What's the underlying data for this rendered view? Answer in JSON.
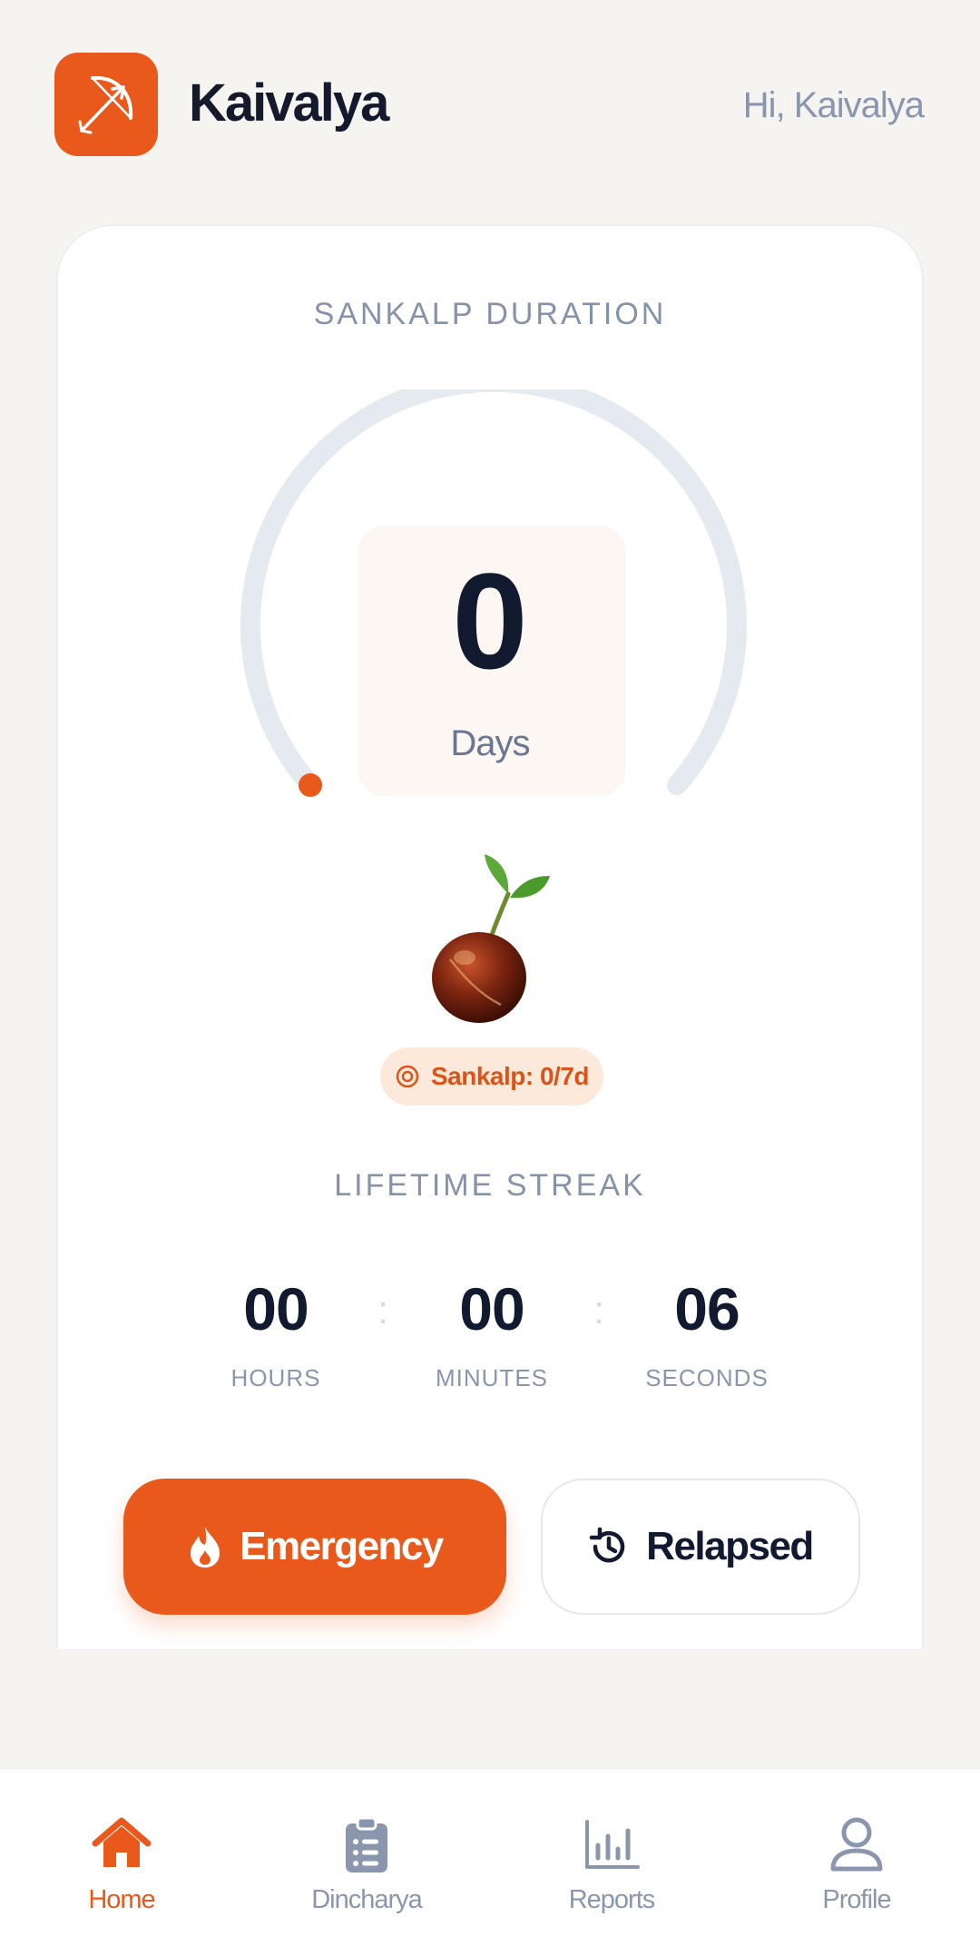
{
  "header": {
    "app_title": "Kaivalya",
    "greeting": "Hi, Kaivalya"
  },
  "sankalp": {
    "title": "SANKALP DURATION",
    "days_value": "0",
    "days_label": "Days",
    "progress_fraction": 0,
    "badge_text": "Sankalp: 0/7d"
  },
  "lifetime": {
    "title": "LIFETIME STREAK",
    "hours": "00",
    "hours_label": "HOURS",
    "minutes": "00",
    "minutes_label": "MINUTES",
    "seconds": "06",
    "seconds_label": "SECONDS",
    "separator": ":"
  },
  "actions": {
    "emergency_label": "Emergency",
    "relapsed_label": "Relapsed"
  },
  "nav": {
    "items": [
      {
        "label": "Home",
        "icon": "home-icon",
        "active": true
      },
      {
        "label": "Dincharya",
        "icon": "clipboard-icon",
        "active": false
      },
      {
        "label": "Reports",
        "icon": "bar-chart-icon",
        "active": false
      },
      {
        "label": "Profile",
        "icon": "user-icon",
        "active": false
      }
    ]
  },
  "colors": {
    "accent": "#e9591b",
    "text_dark": "#111a2e",
    "text_muted": "#8a96ad",
    "gauge_track": "#e5eaf1",
    "badge_bg": "#fde9d9"
  }
}
